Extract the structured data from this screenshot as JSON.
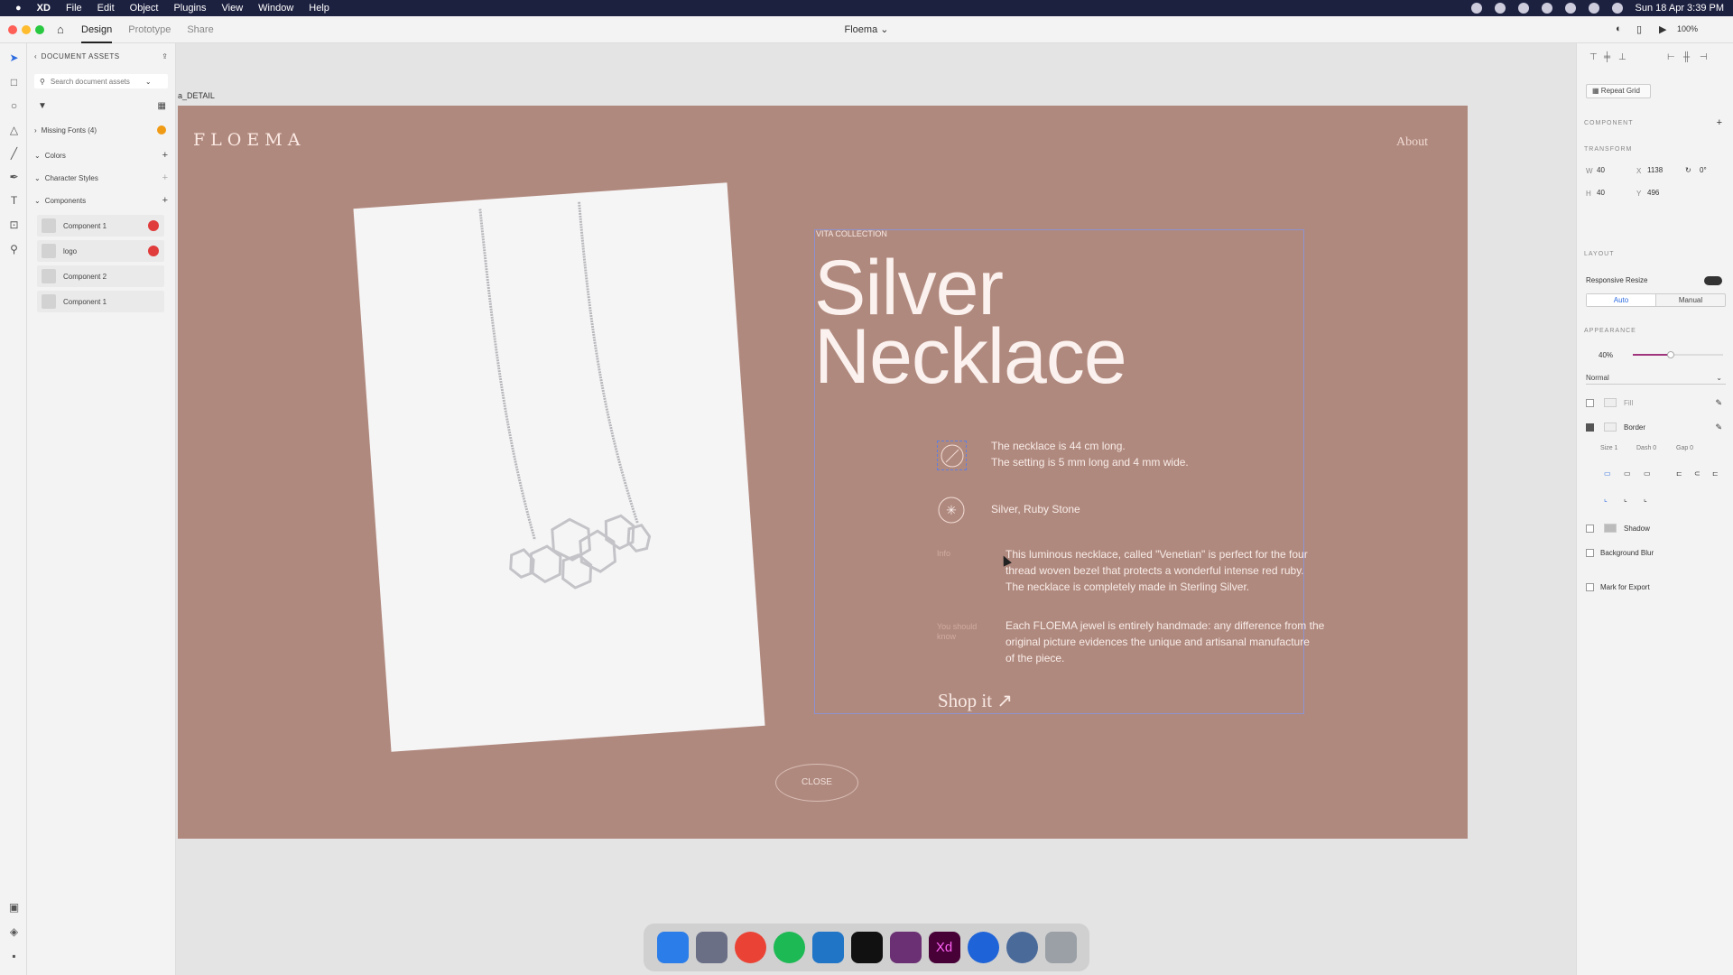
{
  "menubar": {
    "apple": "",
    "app": "XD",
    "items": [
      "File",
      "Edit",
      "Object",
      "Plugins",
      "View",
      "Window",
      "Help"
    ],
    "datetime": "Sun 18 Apr 3:39 PM"
  },
  "toolbar": {
    "tabs": [
      "Design",
      "Prototype",
      "Share"
    ],
    "active_tab": "Design",
    "doc_name": "Floema ⌄",
    "zoom": "100%"
  },
  "assets": {
    "header": "DOCUMENT ASSETS",
    "search_placeholder": "Search document assets",
    "missing_fonts": "Missing Fonts (4)",
    "colors": "Colors",
    "character_styles": "Character Styles",
    "components": "Components",
    "component_items": [
      "Component 1",
      "logo",
      "Component 2",
      "Component 1"
    ]
  },
  "artboard": {
    "name": "a_DETAIL",
    "logo": "FLOEMA",
    "about": "About",
    "collection": "VITA COLLECTION",
    "title_line1": "Silver",
    "title_line2": "Necklace",
    "spec1": "The necklace is 44 cm long.",
    "spec2": "The setting is 5 mm long and 4 mm wide.",
    "stone": "Silver, Ruby Stone",
    "info_label": "Info",
    "info_l1": "This luminous necklace, called \"Venetian\" is perfect for the four",
    "info_l2": "thread woven bezel that protects a wonderful intense red ruby.",
    "info_l3": "The necklace is completely made in Sterling Silver.",
    "know_label1": "You should",
    "know_label2": "know",
    "know_l1": "Each FLOEMA jewel is entirely handmade: any difference from the",
    "know_l2": "original picture evidences the unique and artisanal manufacture",
    "know_l3": "of the piece.",
    "shop": "Shop it ↗",
    "close": "CLOSE"
  },
  "props": {
    "repeat_grid": "Repeat Grid",
    "component": "COMPONENT",
    "transform": "TRANSFORM",
    "w": "40",
    "x": "1138",
    "rotation": "0°",
    "h": "40",
    "y": "496",
    "layout": "LAYOUT",
    "responsive": "Responsive Resize",
    "auto": "Auto",
    "manual": "Manual",
    "appearance": "APPEARANCE",
    "opacity": "40%",
    "blend": "Normal",
    "fill": "Fill",
    "border": "Border",
    "size": "Size 1",
    "dash": "Dash 0",
    "gap": "Gap 0",
    "shadow": "Shadow",
    "bg_blur": "Background Blur",
    "export": "Mark for Export"
  },
  "dock": {
    "apps": [
      "finder",
      "launchpad",
      "chrome",
      "spotify",
      "vscode",
      "terminal",
      "slack",
      "xd",
      "keybase",
      "quicktime",
      "trash"
    ],
    "colors": [
      "#2b7de9",
      "#6a6f86",
      "#ea4335",
      "#1db954",
      "#2075c7",
      "#111111",
      "#6b2f73",
      "#470137",
      "#1e63d8",
      "#4a6a9a",
      "#9aa0a6"
    ]
  }
}
